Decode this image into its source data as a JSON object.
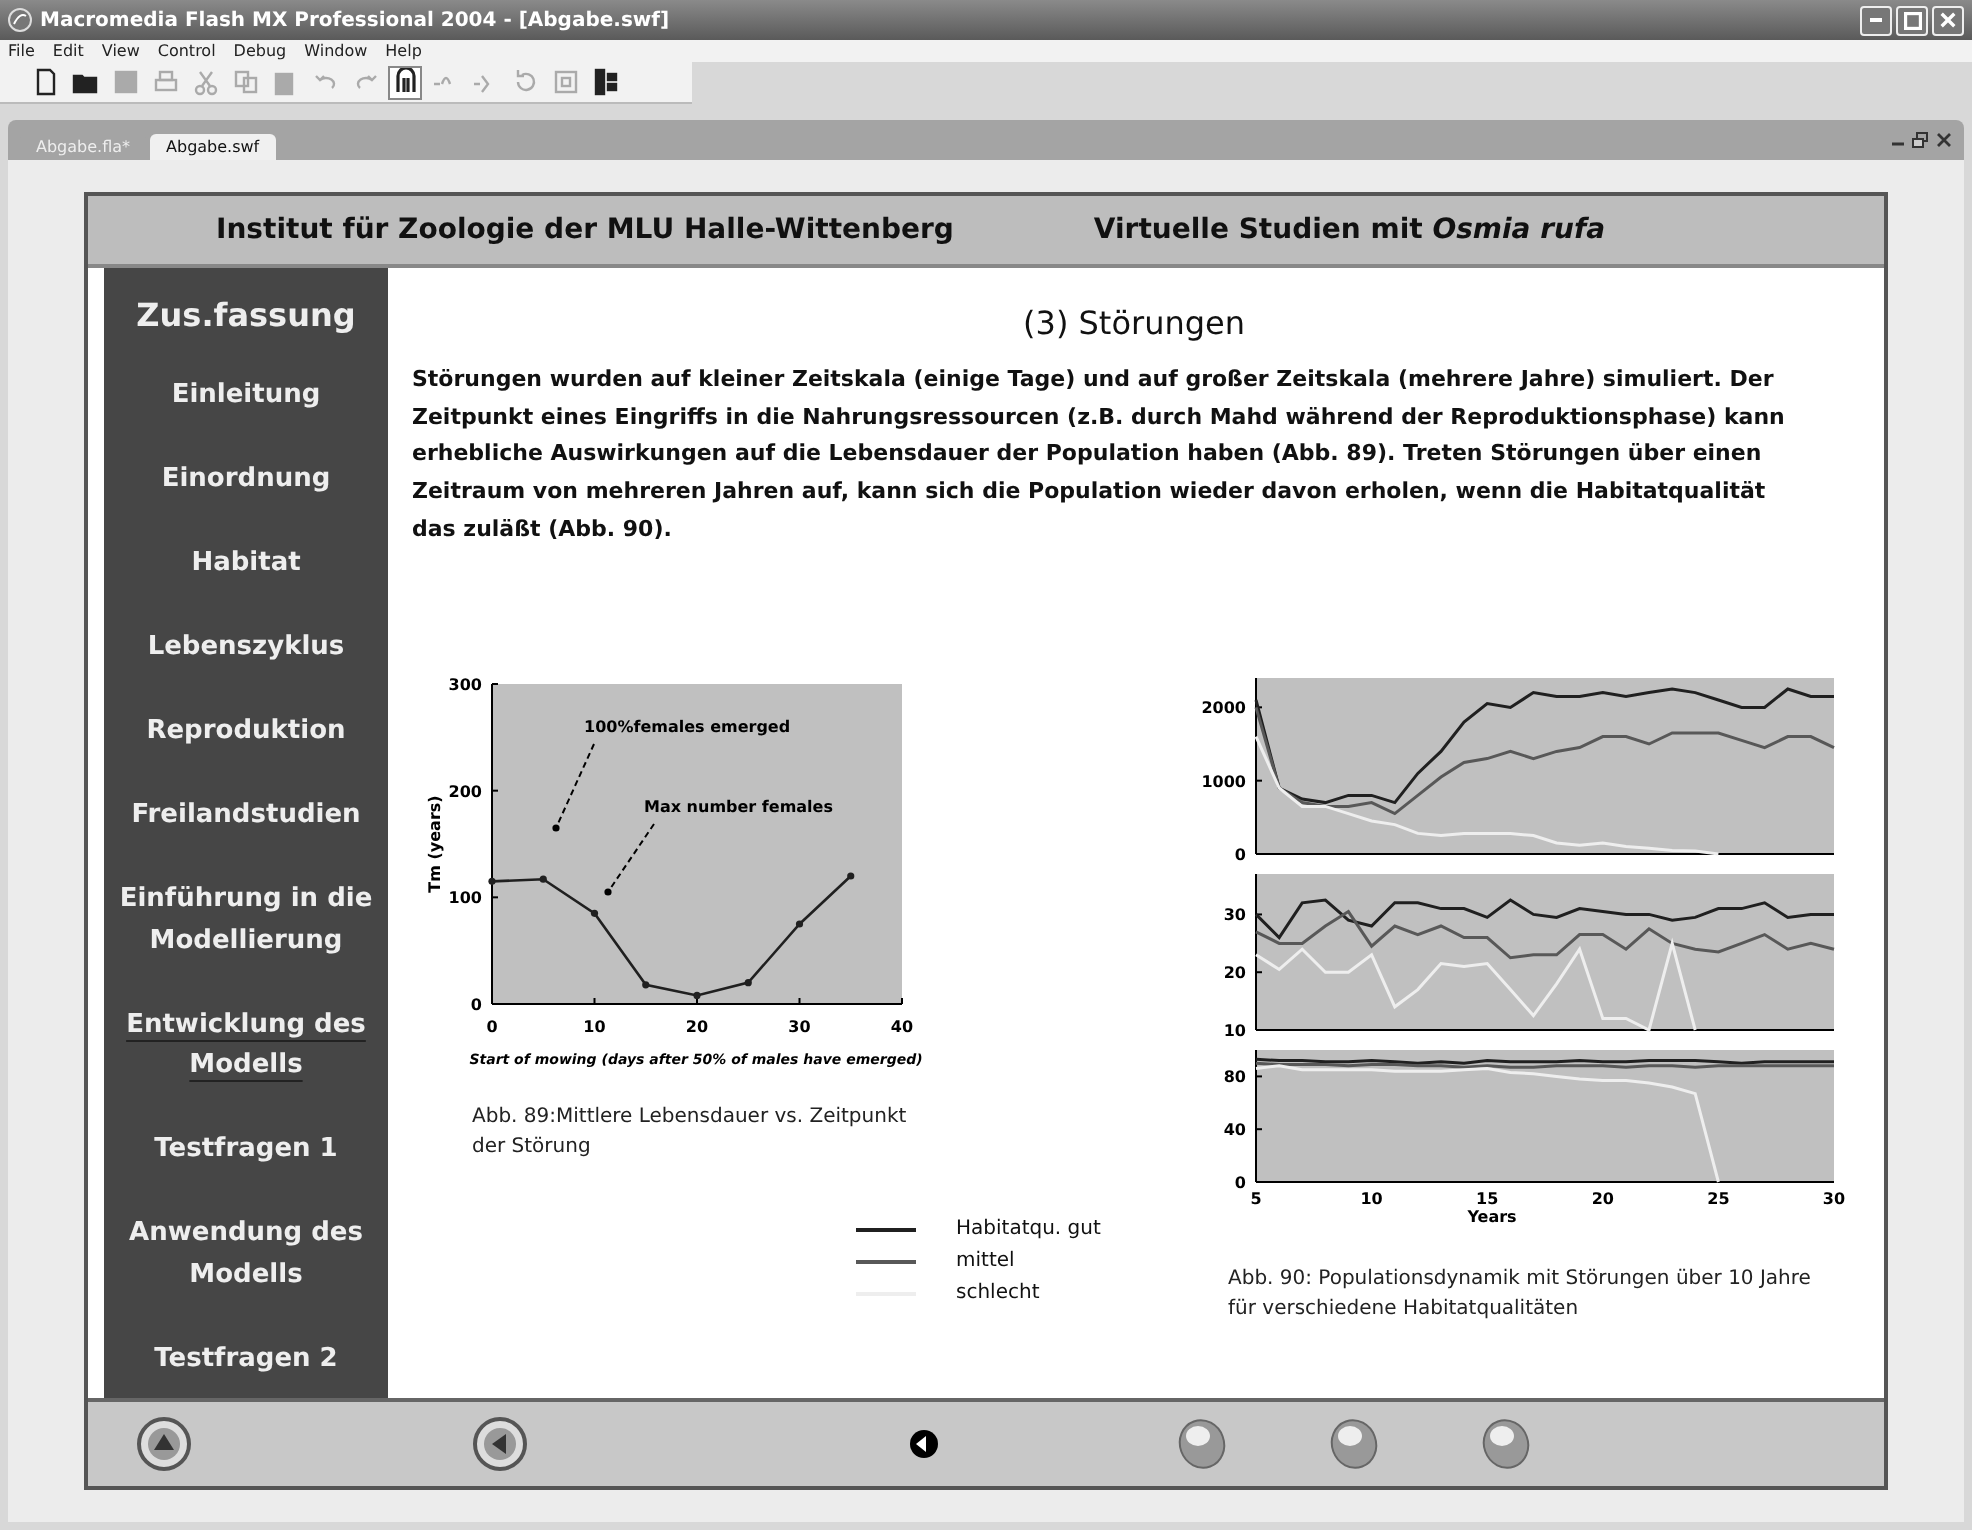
{
  "window": {
    "title": "Macromedia Flash MX Professional 2004 - [Abgabe.swf]"
  },
  "menu": [
    "File",
    "Edit",
    "View",
    "Control",
    "Debug",
    "Window",
    "Help"
  ],
  "toolbar": [
    {
      "kind": "new",
      "disabled": false,
      "on": false
    },
    {
      "kind": "open",
      "disabled": false,
      "on": false
    },
    {
      "kind": "save",
      "disabled": true,
      "on": false
    },
    {
      "kind": "print",
      "disabled": true,
      "on": false
    },
    {
      "kind": "cut",
      "disabled": true,
      "on": false
    },
    {
      "kind": "copy",
      "disabled": true,
      "on": false
    },
    {
      "kind": "paste",
      "disabled": true,
      "on": false
    },
    {
      "kind": "undo",
      "disabled": true,
      "on": false
    },
    {
      "kind": "redo",
      "disabled": true,
      "on": false
    },
    {
      "kind": "snap",
      "disabled": false,
      "on": true
    },
    {
      "kind": "smooth",
      "disabled": true,
      "on": false
    },
    {
      "kind": "straighten",
      "disabled": true,
      "on": false
    },
    {
      "kind": "rotate",
      "disabled": true,
      "on": false
    },
    {
      "kind": "scale",
      "disabled": true,
      "on": false
    },
    {
      "kind": "align",
      "disabled": false,
      "on": false
    }
  ],
  "tabs": [
    {
      "label": "Abgabe.fla*",
      "selected": false
    },
    {
      "label": "Abgabe.swf",
      "selected": true
    }
  ],
  "header": {
    "left": "Institut für Zoologie der MLU Halle-Wittenberg",
    "right": "Virtuelle Studien mit *Osmia rufa*"
  },
  "sidebar": {
    "summary_link": "Zus.fassung",
    "items": [
      {
        "label": "Einleitung",
        "selected": false
      },
      {
        "label": "Einordnung",
        "selected": false
      },
      {
        "label": "Habitat",
        "selected": false
      },
      {
        "label": "Lebenszyklus",
        "selected": false
      },
      {
        "label": "Reproduktion",
        "selected": false
      },
      {
        "label": "Freilandstudien",
        "selected": false
      },
      {
        "label": "Einführung in die Modellierung",
        "selected": false
      },
      {
        "label": "Entwicklung des Modells",
        "selected": true
      },
      {
        "label": "Testfragen 1",
        "selected": false
      },
      {
        "label": "Anwendung des Modells",
        "selected": false
      },
      {
        "label": "Testfragen 2",
        "selected": false
      }
    ]
  },
  "content": {
    "title": "(3) Störungen",
    "paragraph": "Störungen wurden auf kleiner Zeitskala (einige Tage) und auf großer Zeitskala (mehrere Jahre) simuliert. Der Zeitpunkt eines Eingriffs in die Nahrungsressourcen (z.B. durch Mahd während der Reproduktionsphase) kann erhebliche Auswirkungen auf die Lebensdauer der Population haben (Abb. 89). Treten Störungen über einen Zeitraum von mehreren Jahren auf, kann sich die Population wieder davon erholen, wenn die Habitatqualität das zuläßt (Abb. 90).",
    "figure_89": {
      "caption": "Abb. 89:Mittlere Lebensdauer vs. Zeitpunkt der Störung",
      "chart_data": {
        "type": "line",
        "xlabel": "Start of mowing (days after 50% of males have emerged)",
        "ylabel": "Tm (years)",
        "x": [
          0,
          5,
          10,
          15,
          20,
          25,
          30,
          35
        ],
        "series": [
          {
            "color": "#202020",
            "marker": "o",
            "values": [
              115,
              117,
              85,
              18,
              8,
              20,
              75,
              120
            ]
          }
        ],
        "xlim": [
          0,
          40
        ],
        "ylim": [
          0,
          300
        ],
        "xticks": [
          0,
          10,
          20,
          30,
          40
        ],
        "yticks": [
          0,
          100,
          200,
          300
        ],
        "annotations": [
          "100%females emerged",
          "Max number females"
        ]
      }
    },
    "figure_90": {
      "caption": "Abb. 90: Populationsdynamik mit Störungen über 10 Jahre für verschiedene Habitatqualitäten",
      "panels": [
        {
          "chart_data": {
            "type": "line",
            "x": [
              5,
              6,
              7,
              8,
              9,
              10,
              11,
              12,
              13,
              14,
              15,
              16,
              17,
              18,
              19,
              20,
              21,
              22,
              23,
              24,
              25,
              26,
              27,
              28,
              29,
              30
            ],
            "xlim": [
              5,
              30
            ],
            "ylim": [
              0,
              2400
            ],
            "yticks": [
              0,
              1000,
              2000
            ],
            "series": [
              {
                "color": "#202020",
                "values": [
                  2100,
                  900,
                  750,
                  700,
                  800,
                  800,
                  700,
                  1100,
                  1400,
                  1800,
                  2050,
                  2000,
                  2200,
                  2150,
                  2150,
                  2200,
                  2150,
                  2200,
                  2250,
                  2200,
                  2100,
                  2000,
                  2000,
                  2250,
                  2150,
                  2150
                ]
              },
              {
                "color": "#585858",
                "values": [
                  2000,
                  900,
                  700,
                  650,
                  650,
                  700,
                  550,
                  800,
                  1050,
                  1250,
                  1300,
                  1400,
                  1300,
                  1400,
                  1450,
                  1600,
                  1600,
                  1500,
                  1650,
                  1650,
                  1650,
                  1550,
                  1450,
                  1600,
                  1600,
                  1450
                ]
              },
              {
                "color": "#eeeeee",
                "values": [
                  1600,
                  900,
                  650,
                  650,
                  550,
                  450,
                  400,
                  280,
                  250,
                  280,
                  280,
                  280,
                  250,
                  150,
                  120,
                  150,
                  100,
                  80,
                  50,
                  40,
                  0,
                  null,
                  null,
                  null,
                  null,
                  null
                ]
              }
            ]
          }
        },
        {
          "chart_data": {
            "type": "line",
            "x": [
              5,
              6,
              7,
              8,
              9,
              10,
              11,
              12,
              13,
              14,
              15,
              16,
              17,
              18,
              19,
              20,
              21,
              22,
              23,
              24,
              25,
              26,
              27,
              28,
              29,
              30
            ],
            "xlim": [
              5,
              30
            ],
            "ylim": [
              10,
              37
            ],
            "yticks": [
              10,
              20,
              30
            ],
            "series": [
              {
                "color": "#202020",
                "values": [
                  30,
                  26,
                  32,
                  32.5,
                  29,
                  28,
                  32,
                  32,
                  31,
                  31,
                  29.5,
                  32.5,
                  30,
                  29.5,
                  31,
                  30.5,
                  30,
                  30,
                  29,
                  29.5,
                  31,
                  31,
                  32,
                  29.5,
                  30,
                  30
                ]
              },
              {
                "color": "#585858",
                "values": [
                  27,
                  25,
                  25,
                  28,
                  30.5,
                  24.5,
                  28,
                  26.5,
                  28,
                  26,
                  26,
                  22.5,
                  23,
                  23,
                  26.5,
                  26.5,
                  24,
                  27.5,
                  25,
                  24,
                  23.5,
                  25,
                  26.5,
                  24,
                  25,
                  24
                ]
              },
              {
                "color": "#eeeeee",
                "values": [
                  23,
                  20.5,
                  24,
                  20,
                  20,
                  23,
                  14,
                  17,
                  21.5,
                  21,
                  21.5,
                  17,
                  12.5,
                  18,
                  24,
                  12,
                  12,
                  10,
                  25,
                  10,
                  null,
                  null,
                  null,
                  null,
                  null,
                  null
                ]
              }
            ]
          }
        },
        {
          "chart_data": {
            "type": "line",
            "xlabel": "Years",
            "x": [
              5,
              6,
              7,
              8,
              9,
              10,
              11,
              12,
              13,
              14,
              15,
              16,
              17,
              18,
              19,
              20,
              21,
              22,
              23,
              24,
              25,
              26,
              27,
              28,
              29,
              30
            ],
            "xlim": [
              5,
              30
            ],
            "ylim": [
              0,
              100
            ],
            "xticks": [
              5,
              10,
              15,
              20,
              25,
              30
            ],
            "yticks": [
              0,
              40,
              80
            ],
            "series": [
              {
                "color": "#202020",
                "values": [
                  93,
                  92,
                  92,
                  91,
                  91,
                  92,
                  91,
                  90,
                  91,
                  90,
                  92,
                  91,
                  91,
                  91,
                  92,
                  91,
                  91,
                  92,
                  92,
                  92,
                  91,
                  90,
                  91,
                  91,
                  91,
                  91
                ]
              },
              {
                "color": "#585858",
                "values": [
                  90,
                  89,
                  89,
                  89,
                  88,
                  89,
                  89,
                  88,
                  88,
                  87,
                  88,
                  87,
                  87,
                  88,
                  88,
                  88,
                  87,
                  88,
                  88,
                  87,
                  88,
                  88,
                  88,
                  88,
                  88,
                  88
                ]
              },
              {
                "color": "#eeeeee",
                "values": [
                  86,
                  88,
                  85,
                  85,
                  85,
                  85,
                  84,
                  84,
                  84,
                  85,
                  86,
                  83,
                  82,
                  80,
                  78,
                  77,
                  77,
                  75,
                  72,
                  67,
                  0,
                  null,
                  null,
                  null,
                  null,
                  null
                ]
              }
            ]
          }
        }
      ]
    },
    "legend": [
      {
        "label": "Habitatqu. gut",
        "color": "#202020"
      },
      {
        "label": "mittel",
        "color": "#585858"
      },
      {
        "label": "schlecht",
        "color": "#eeeeee"
      }
    ]
  },
  "navigation": [
    {
      "kind": "up"
    },
    {
      "kind": "back"
    },
    {
      "kind": "home"
    },
    {
      "kind": "blank"
    },
    {
      "kind": "blank"
    },
    {
      "kind": "blank"
    }
  ]
}
